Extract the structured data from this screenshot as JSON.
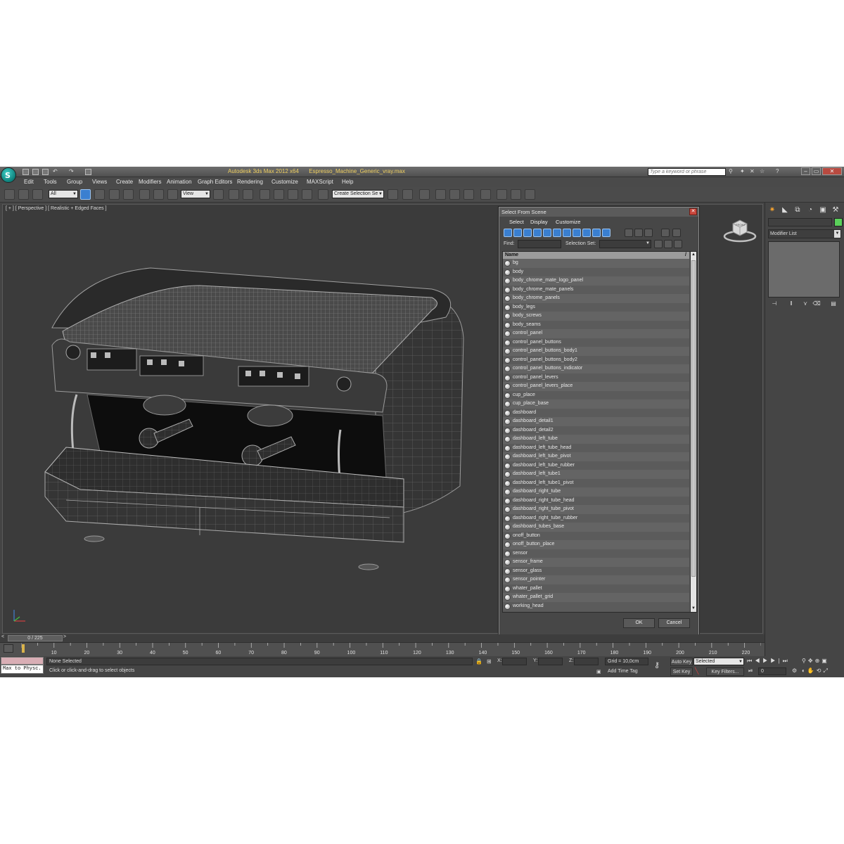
{
  "app": {
    "title_app": "Autodesk 3ds Max  2012 x64",
    "title_file": "Espresso_Machine_Generic_vray.max",
    "search_placeholder": "Type a keyword or phrase",
    "logo_letter": "S"
  },
  "menu": [
    "Edit",
    "Tools",
    "Group",
    "Views",
    "Create",
    "Modifiers",
    "Animation",
    "Graph Editors",
    "Rendering",
    "Customize",
    "MAXScript",
    "Help"
  ],
  "toolbar": {
    "filter_value": "All",
    "refcoord_value": "View",
    "selection_set_value": "Create Selection Se"
  },
  "viewport": {
    "label": "[ + ] [ Perspective ] [ Realistic + Edged Faces ]",
    "viewcube_face": "FRONT"
  },
  "command_panel": {
    "modifier_list": "Modifier List"
  },
  "dialog": {
    "title": "Select From Scene",
    "menu": [
      "Select",
      "Display",
      "Customize"
    ],
    "find_label": "Find:",
    "selection_set_label": "Selection Set:",
    "column_name": "Name",
    "items": [
      "bg",
      "body",
      "body_chrome_mate_logo_panel",
      "body_chrome_mate_panels",
      "body_chrome_panels",
      "body_legs",
      "body_screws",
      "body_seams",
      "control_panel",
      "control_panel_buttons",
      "control_panel_buttons_body1",
      "control_panel_buttons_body2",
      "control_panel_buttons_indicator",
      "control_panel_levers",
      "control_panel_levers_place",
      "cup_place",
      "cup_place_base",
      "dashboard",
      "dashboard_detail1",
      "dashboard_detail2",
      "dashboard_left_tube",
      "dashboard_left_tube_head",
      "dashboard_left_tube_pivot",
      "dashboard_left_tube_rubber",
      "dashboard_left_tube1",
      "dashboard_left_tube1_pivot",
      "dashboard_right_tube",
      "dashboard_right_tube_head",
      "dashboard_right_tube_pivot",
      "dashboard_right_tube_rubber",
      "dashboard_tubes_base",
      "onoff_button",
      "onoff_button_place",
      "sensor",
      "sensor_frame",
      "sensor_glass",
      "sensor_pointer",
      "whater_pallet",
      "whater_pallet_grid",
      "working_head"
    ],
    "ok_label": "OK",
    "cancel_label": "Cancel"
  },
  "timeline": {
    "frame_display": "0 / 225",
    "prev_arrow": "<",
    "next_arrow": ">",
    "ticks": [
      "10",
      "20",
      "30",
      "40",
      "50",
      "60",
      "70",
      "80",
      "90",
      "100",
      "110",
      "120",
      "130",
      "140",
      "150",
      "160",
      "170",
      "180",
      "190",
      "200",
      "210",
      "220"
    ]
  },
  "status": {
    "maxscript_label": "Max to Physc.",
    "selection_text": "None Selected",
    "prompt_text": "Click or click-and-drag to select objects",
    "x_label": "X:",
    "y_label": "Y:",
    "z_label": "Z:",
    "grid_text": "Grid = 10,0cm",
    "add_time_tag": "Add Time Tag",
    "auto_key": "Auto Key",
    "selected_value": "Selected",
    "set_key": "Set Key",
    "key_filters": "Key Filters...",
    "current_frame": "0"
  },
  "colors": {
    "title_text": "#f0d060",
    "accent_blue": "#3a7fd0",
    "object_color": "#5ad05a",
    "maxscript_pink": "#d9aeb5"
  }
}
